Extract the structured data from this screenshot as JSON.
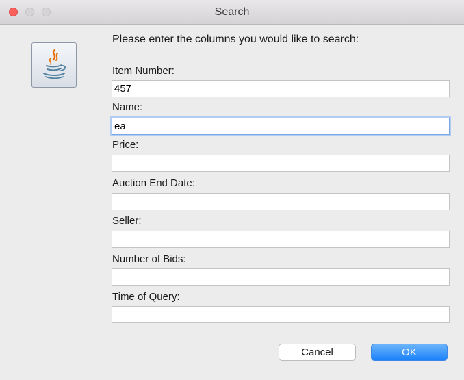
{
  "window": {
    "title": "Search"
  },
  "dialog": {
    "prompt": "Please enter the columns you would like to search:",
    "icon": "java-coffee-cup-icon",
    "fields": [
      {
        "label": "Item Number:",
        "value": "457",
        "placeholder": ""
      },
      {
        "label": "Name:",
        "value": "ea",
        "placeholder": ""
      },
      {
        "label": "Price:",
        "value": "",
        "placeholder": ""
      },
      {
        "label": "Auction End Date:",
        "value": "",
        "placeholder": ""
      },
      {
        "label": "Seller:",
        "value": "",
        "placeholder": ""
      },
      {
        "label": "Number of Bids:",
        "value": "",
        "placeholder": ""
      },
      {
        "label": "Time of Query:",
        "value": "",
        "placeholder": ""
      }
    ]
  },
  "buttons": {
    "cancel_label": "Cancel",
    "ok_label": "OK"
  },
  "colors": {
    "close": "#fc605c",
    "accent": "#1a82fb",
    "focus_ring": "#7aa7e5",
    "background": "#ececec"
  }
}
